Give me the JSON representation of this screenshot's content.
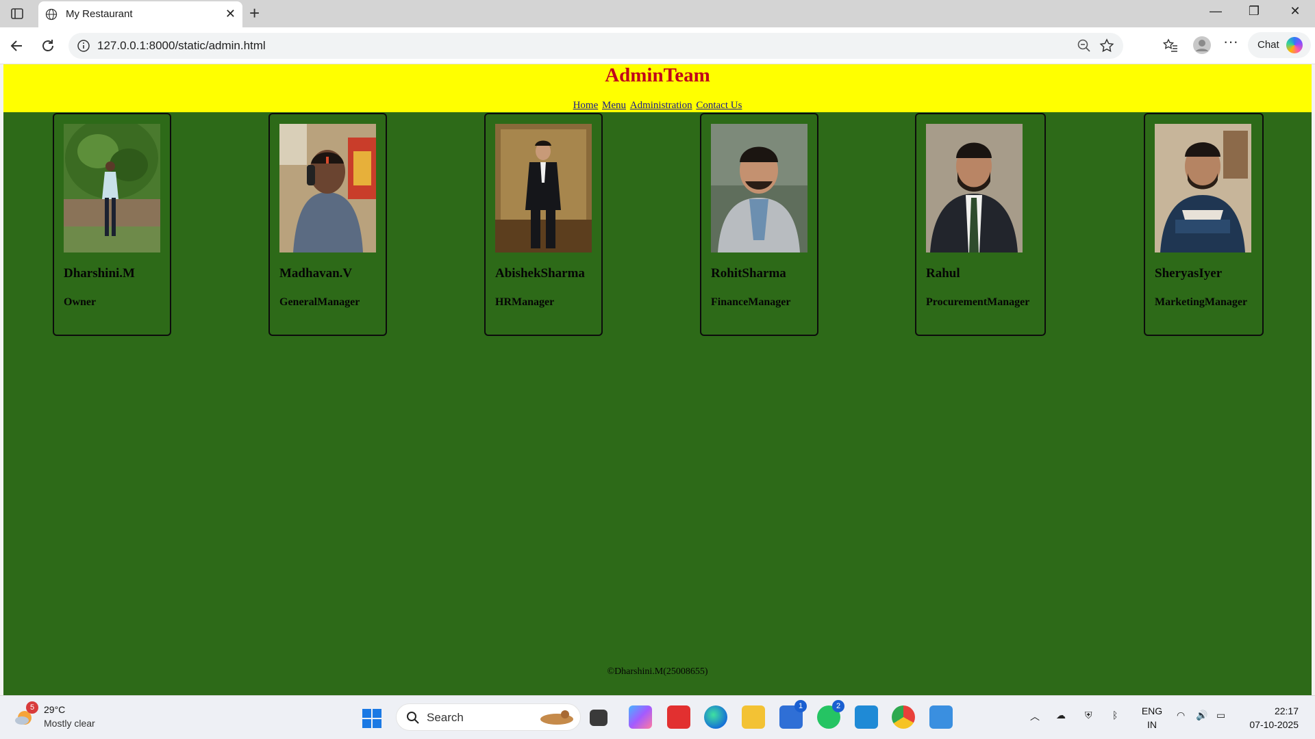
{
  "browser": {
    "tab_title": "My Restaurant",
    "url": "127.0.0.1:8000/static/admin.html",
    "chat_label": "Chat"
  },
  "page": {
    "title": "AdminTeam",
    "nav": [
      "Home",
      "Menu",
      "Administration",
      "Contact Us"
    ],
    "footer": "©Dharshini.M(25008655)",
    "colors": {
      "header_bg": "#ffff00",
      "title": "#c0001b",
      "body_bg": "#2d6a18"
    }
  },
  "team": [
    {
      "name": "Dharshini.M",
      "role": "Owner"
    },
    {
      "name": "Madhavan.V",
      "role": "GeneralManager"
    },
    {
      "name": "AbishekSharma",
      "role": "HRManager"
    },
    {
      "name": "RohitSharma",
      "role": "FinanceManager"
    },
    {
      "name": "Rahul",
      "role": "ProcurementManager"
    },
    {
      "name": "SheryasIyer",
      "role": "MarketingManager"
    }
  ],
  "taskbar": {
    "weather_temp": "29°C",
    "weather_cond": "Mostly clear",
    "weather_badge": "5",
    "search_label": "Search",
    "store_badge": "1",
    "whatsapp_badge": "2",
    "lang_1": "ENG",
    "lang_2": "IN",
    "time": "22:17",
    "date": "07-10-2025"
  }
}
